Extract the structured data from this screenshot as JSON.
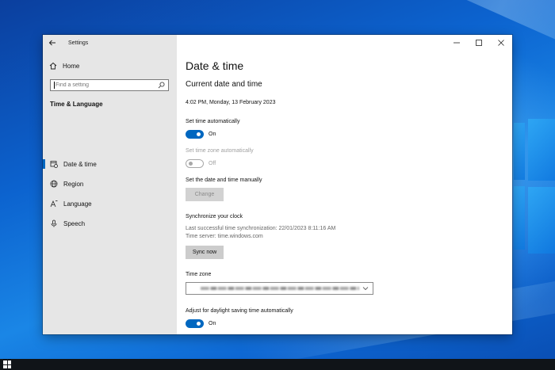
{
  "window": {
    "app_title": "Settings",
    "controls": {
      "minimize": "minimize",
      "maximize": "maximize",
      "close": "close"
    }
  },
  "sidebar": {
    "home_label": "Home",
    "search_placeholder": "Find a setting",
    "section_title": "Time & Language",
    "items": [
      {
        "label": "Date & time",
        "icon": "calendar-clock-icon",
        "selected": true
      },
      {
        "label": "Region",
        "icon": "globe-icon",
        "selected": false
      },
      {
        "label": "Language",
        "icon": "language-icon",
        "selected": false
      },
      {
        "label": "Speech",
        "icon": "microphone-icon",
        "selected": false
      }
    ]
  },
  "main": {
    "page_title": "Date & time",
    "current_heading": "Current date and time",
    "current_value": "4:02 PM, Monday, 13 February 2023",
    "set_time_auto": {
      "label": "Set time automatically",
      "state": "On",
      "on": true
    },
    "set_tz_auto": {
      "label": "Set time zone automatically",
      "state": "Off",
      "on": false,
      "disabled": true
    },
    "set_manual": {
      "label": "Set the date and time manually",
      "button": "Change",
      "disabled": true
    },
    "sync": {
      "heading": "Synchronize your clock",
      "last_sync": "Last successful time synchronization: 22/01/2023 8:11:16 AM",
      "server": "Time server: time.windows.com",
      "button": "Sync now"
    },
    "time_zone": {
      "label": "Time zone",
      "value_blurred": true
    },
    "daylight": {
      "label": "Adjust for daylight saving time automatically",
      "state": "On",
      "on": true
    }
  },
  "colors": {
    "accent": "#0067c0",
    "sidebar_bg": "#e6e6e6",
    "desktop": "#0c63cf"
  }
}
